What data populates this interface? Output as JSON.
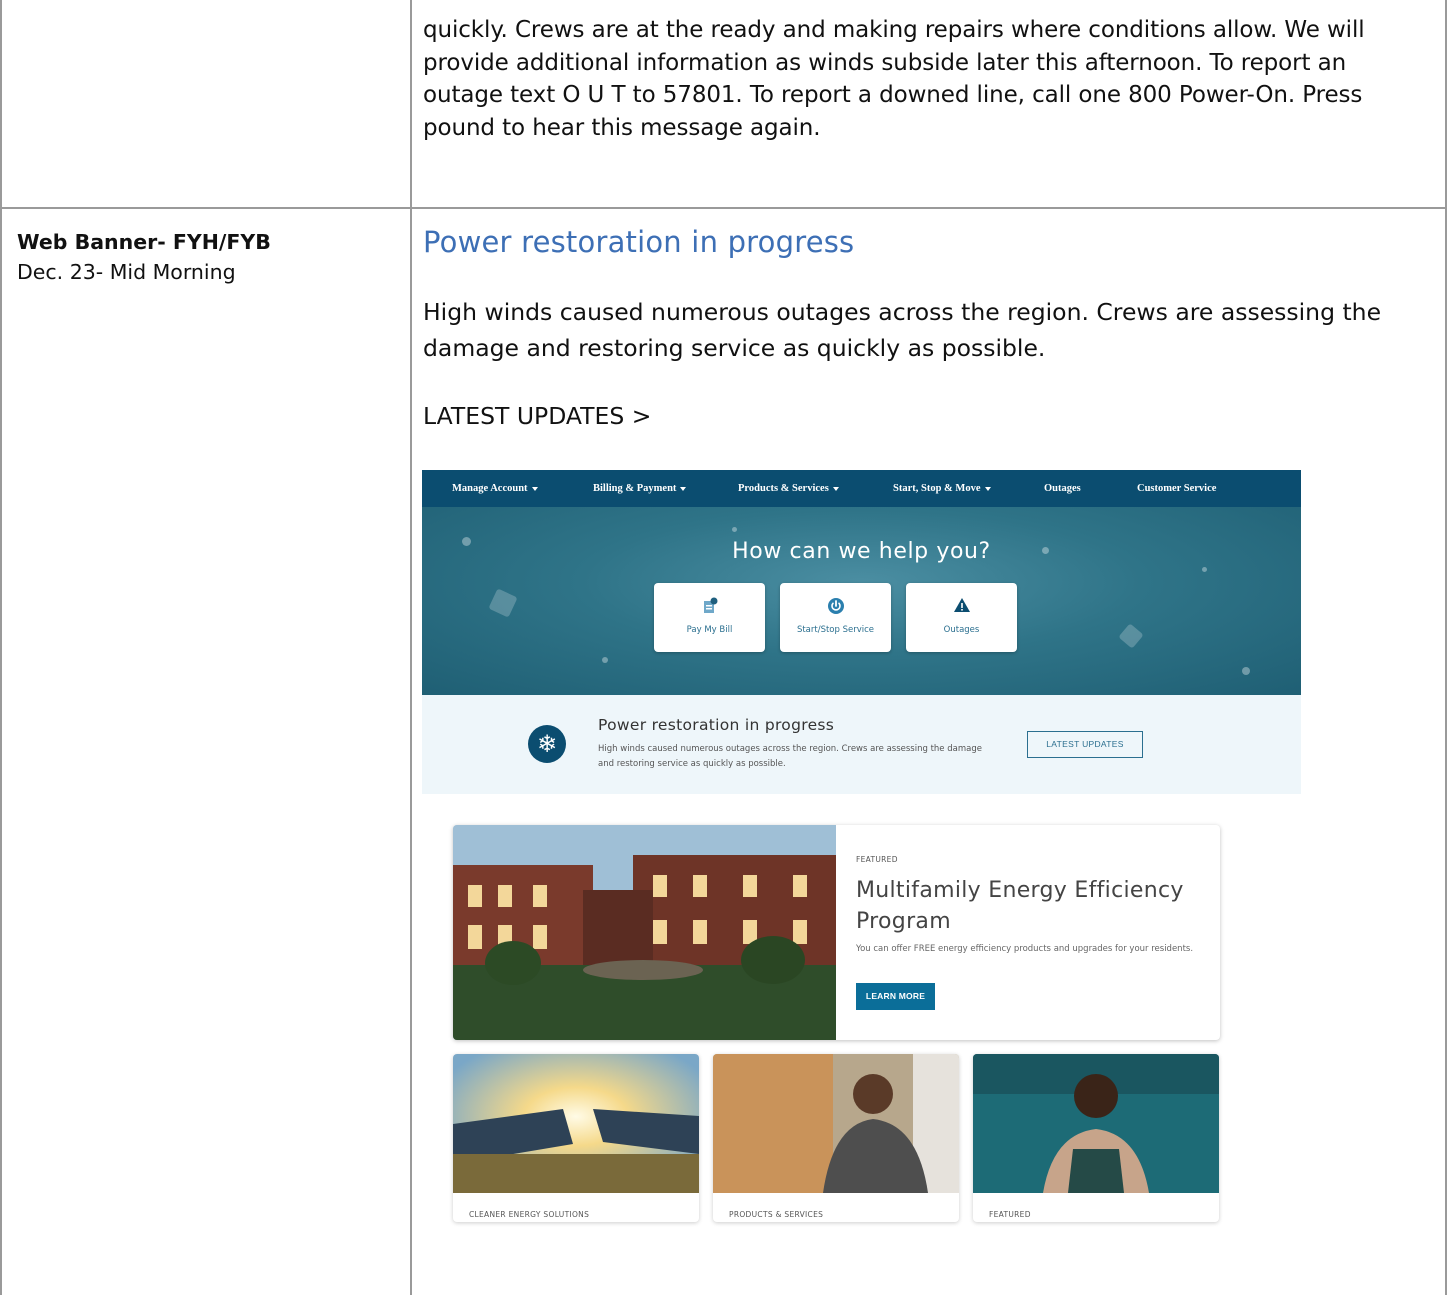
{
  "top_row": {
    "text": "quickly. Crews are at the ready and making repairs where conditions allow. We will provide additional information as winds subside later this afternoon. To report an outage text  O U T to 57801. To report a downed line, call one 800 Power-On. Press pound to hear this message again."
  },
  "row": {
    "label_title": "Web Banner- FYH/FYB",
    "label_sub": "Dec. 23- Mid Morning",
    "heading": "Power restoration in progress",
    "body": "High winds caused numerous outages across the region. Crews are assessing the damage and restoring service as quickly as possible.",
    "link": "LATEST UPDATES >"
  },
  "site": {
    "nav": [
      {
        "label": "Manage Account",
        "dropdown": true
      },
      {
        "label": "Billing & Payment",
        "dropdown": true
      },
      {
        "label": "Products & Services",
        "dropdown": true
      },
      {
        "label": "Start, Stop & Move",
        "dropdown": true
      },
      {
        "label": "Outages",
        "dropdown": false
      },
      {
        "label": "Customer Service",
        "dropdown": false
      }
    ],
    "hero_title": "How can we help you?",
    "tiles": [
      {
        "label": "Pay My Bill",
        "icon": "bill-icon"
      },
      {
        "label": "Start/Stop Service",
        "icon": "power-icon"
      },
      {
        "label": "Outages",
        "icon": "warning-icon"
      }
    ],
    "alert": {
      "icon": "snowflake-icon",
      "title": "Power restoration in progress",
      "body": "High winds caused numerous outages across the region. Crews are assessing the damage and restoring service as quickly as possible.",
      "button": "LATEST UPDATES"
    },
    "feature": {
      "kicker": "FEATURED",
      "title": "Multifamily Energy Efficiency Program",
      "desc": "You can offer FREE energy efficiency products and upgrades for your residents.",
      "button": "LEARN MORE"
    },
    "cards": [
      {
        "label": "CLEANER ENERGY SOLUTIONS"
      },
      {
        "label": "PRODUCTS & SERVICES"
      },
      {
        "label": "FEATURED"
      }
    ],
    "colors": {
      "nav": "#0b4d70",
      "accent": "#0b6e99",
      "heading_blue": "#3d6fb5",
      "alert_bg": "#eef6fa"
    }
  }
}
